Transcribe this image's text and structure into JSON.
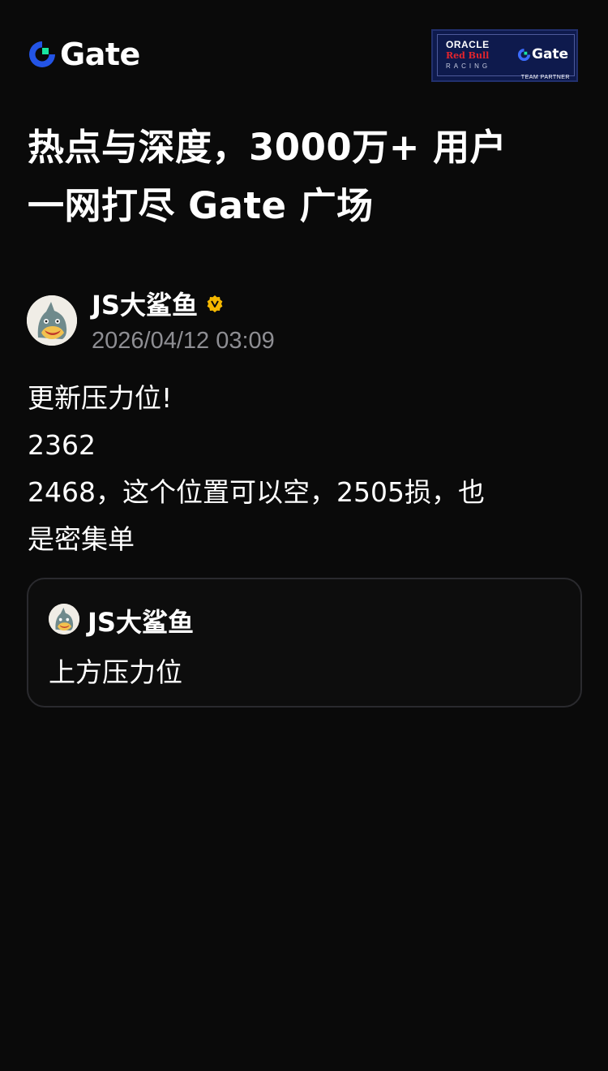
{
  "header": {
    "logo_text": "Gate",
    "partner": {
      "oracle": "ORACLE",
      "redbull": "Red Bull",
      "racing": "RACING",
      "gate": "Gate",
      "team_partner": "TEAM PARTNER"
    }
  },
  "headline": {
    "line1": "热点与深度，3000万+ 用户",
    "line2": "一网打尽 Gate 广场"
  },
  "post": {
    "author": "JS大鲨鱼",
    "verified_icon": "verified-badge-icon",
    "timestamp": "2026/04/12 03:09",
    "lines": [
      "更新压力位!",
      "2362",
      "2468，这个位置可以空，2505损，也",
      "是密集单"
    ]
  },
  "quote": {
    "author": "JS大鲨鱼",
    "text": "上方压力位"
  },
  "colors": {
    "background": "#0a0a0a",
    "text": "#ffffff",
    "muted": "#8e8e93",
    "brand_blue": "#2354e6",
    "brand_green": "#17e6a1",
    "verified": "#f5b800",
    "card_border": "#2a2a2e"
  }
}
